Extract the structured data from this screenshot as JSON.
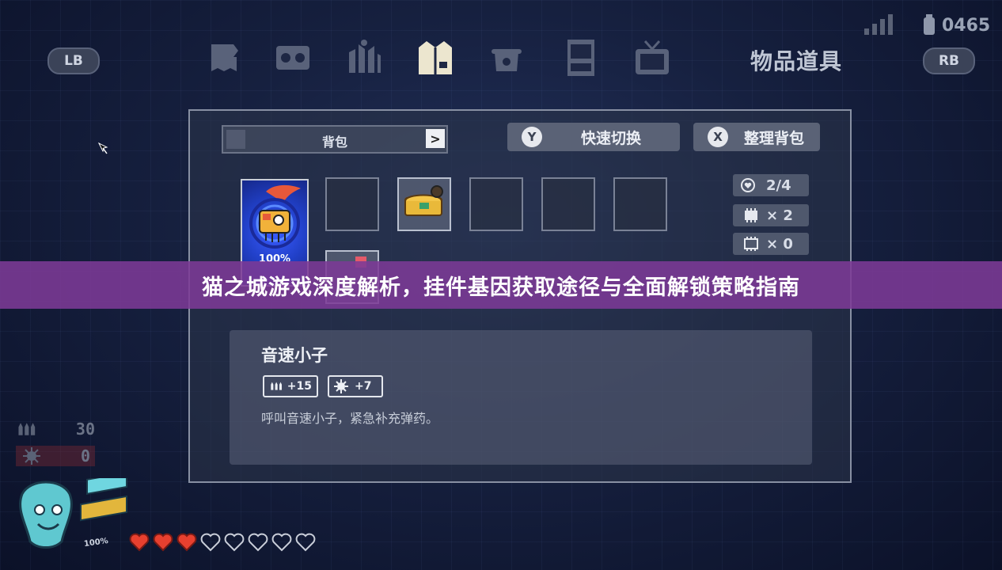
{
  "hud_top": {
    "left_shoulder": "LB",
    "right_shoulder": "RB",
    "tab_title": "物品道具",
    "tabs": [
      "map-tab",
      "radio-tab",
      "city-tab",
      "outfit-tab",
      "pot-tab",
      "vending-tab",
      "tv-tab"
    ],
    "active_tab": "outfit-tab",
    "status_count": "0465"
  },
  "inventory": {
    "bag_label": "背包",
    "next_label": ">",
    "quick_switch": {
      "key": "Y",
      "label": "快速切换"
    },
    "sort_bag": {
      "key": "X",
      "label": "整理背包"
    },
    "equipped_card_percent": "100%",
    "stats": [
      {
        "icon": "heart-ring-icon",
        "value": "2/4"
      },
      {
        "icon": "chip-icon",
        "value": "× 2"
      },
      {
        "icon": "chip-outline-icon",
        "value": "× 0"
      }
    ]
  },
  "banner": {
    "title": "猫之城游戏深度解析，挂件基因获取途径与全面解锁策略指南"
  },
  "item_detail": {
    "name": "音速小子",
    "chips": [
      {
        "icon": "ammo-icon",
        "value": "+15"
      },
      {
        "icon": "gear-icon",
        "value": "+7"
      }
    ],
    "description": "呼叫音速小子，紧急补充弹药。"
  },
  "player_hud": {
    "ammo": "30",
    "special": "0",
    "health_percent": "100%",
    "hearts_filled": 3,
    "hearts_total": 8,
    "heart_color": "#e8402f"
  }
}
